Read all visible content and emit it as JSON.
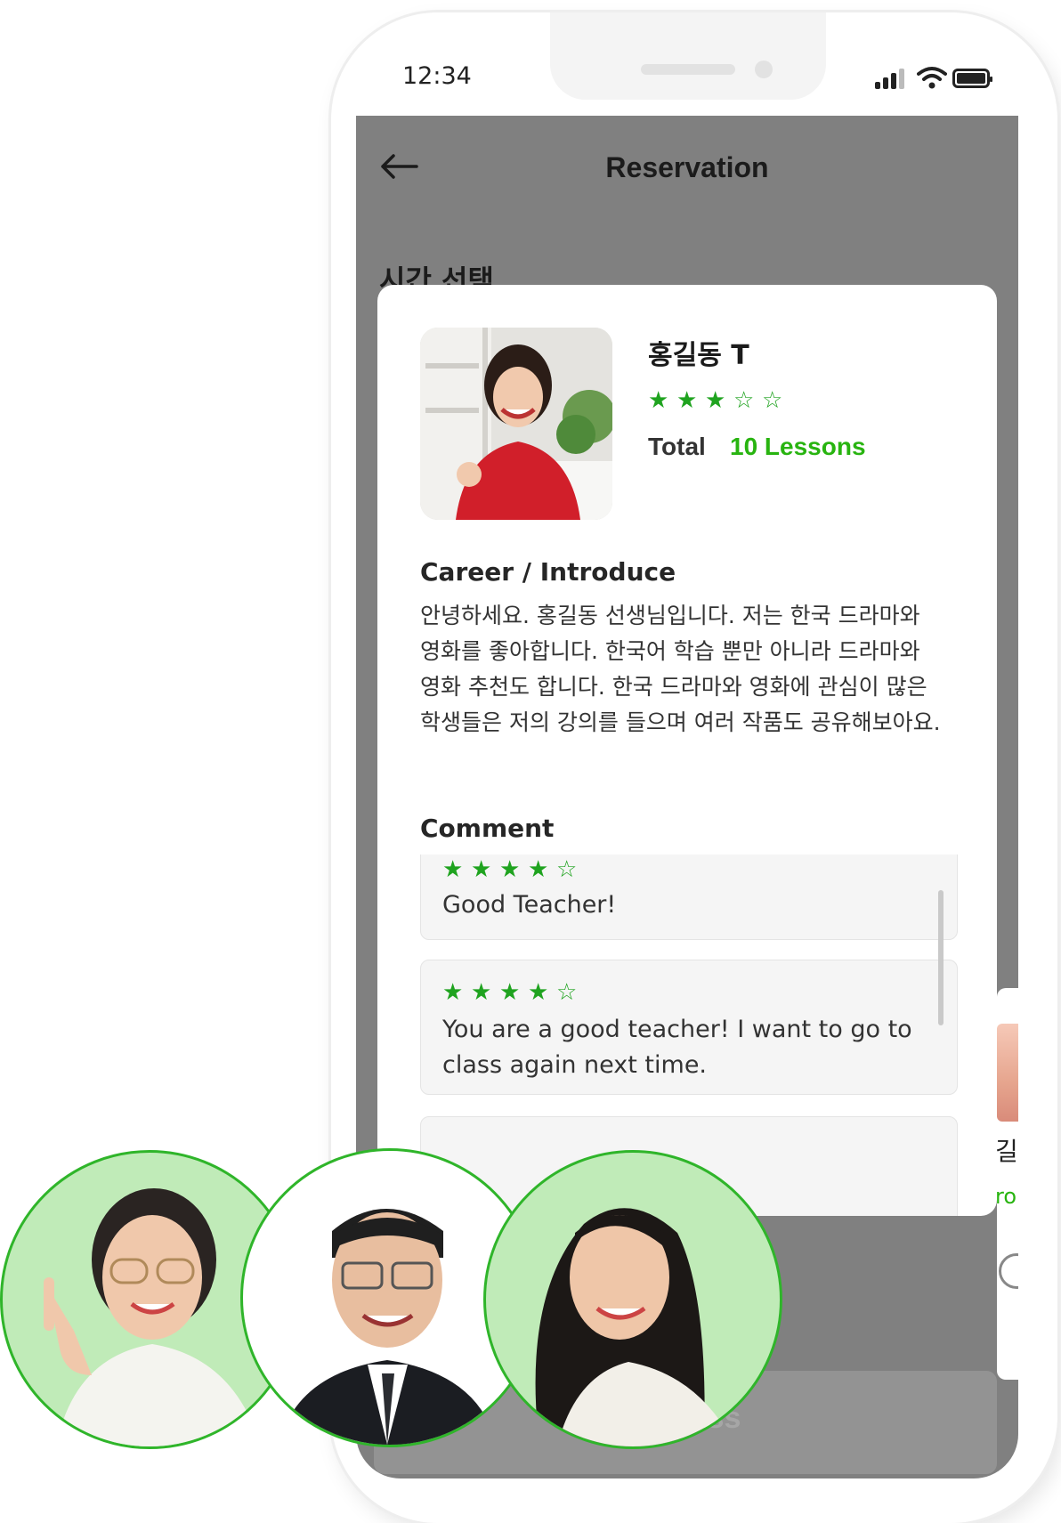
{
  "status_bar": {
    "time": "12:34"
  },
  "header": {
    "title": "Reservation",
    "back_icon": "back-arrow-icon"
  },
  "section": {
    "title": "시간 선택"
  },
  "teacher": {
    "name": "홍길동 T",
    "rating": 3,
    "rating_max": 5,
    "total_label": "Total",
    "lessons": "10 Lessons"
  },
  "career": {
    "title": "Career / Introduce",
    "body": "안녕하세요. 홍길동 선생님입니다. 저는 한국 드라마와 영화를 좋아합니다. 한국어 학습 뿐만 아니라 드라마와 영화 추천도 합니다. 한국 드라마와 영화에 관심이 많은 학생들은 저의 강의를 들으며 여러 작품도 공유해보아요."
  },
  "comments": {
    "title": "Comment",
    "items": [
      {
        "rating": 4,
        "text": "Good Teacher!"
      },
      {
        "rating": 4,
        "text": "You are a good teacher! I want to go to class again next time."
      }
    ]
  },
  "peek_card": {
    "name": "길",
    "green_text": "ro"
  },
  "next_button": {
    "label": "xt class"
  },
  "colors": {
    "accent": "#28b410",
    "overlay": "#808080",
    "circle_border": "#2fb52a",
    "circle_bg": "#c0ebb8"
  }
}
